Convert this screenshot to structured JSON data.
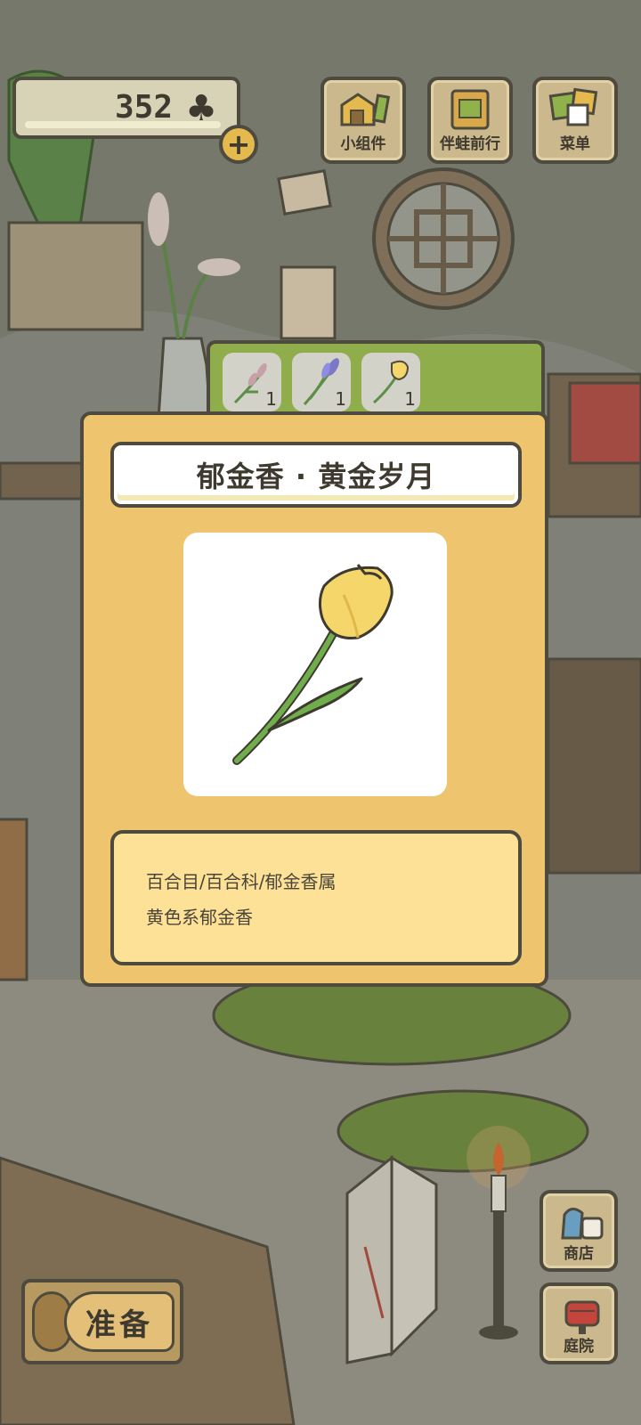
{
  "currency": {
    "amount": "352",
    "icon": "clover-icon"
  },
  "top_buttons": [
    {
      "label": "小组件",
      "icon": "widget-icon"
    },
    {
      "label": "伴蛙前行",
      "icon": "frog-card-icon"
    },
    {
      "label": "菜单",
      "icon": "menu-icon"
    }
  ],
  "flower_tabs": [
    {
      "name": "lavender",
      "count": "1"
    },
    {
      "name": "iris",
      "count": "1"
    },
    {
      "name": "tulip",
      "count": "1"
    }
  ],
  "detail": {
    "title": "郁金香 · 黄金岁月",
    "classification": "百合目/百合科/郁金香属",
    "description": "黄色系郁金香"
  },
  "bottom": {
    "ready_label": "准备",
    "shop_label": "商店",
    "yard_label": "庭院"
  },
  "colors": {
    "card_bg": "#efc46e",
    "desc_bg": "#fde197",
    "tab_strip": "#8fad4a",
    "tulip_petal": "#f5d66a",
    "stem": "#6fae4a"
  }
}
